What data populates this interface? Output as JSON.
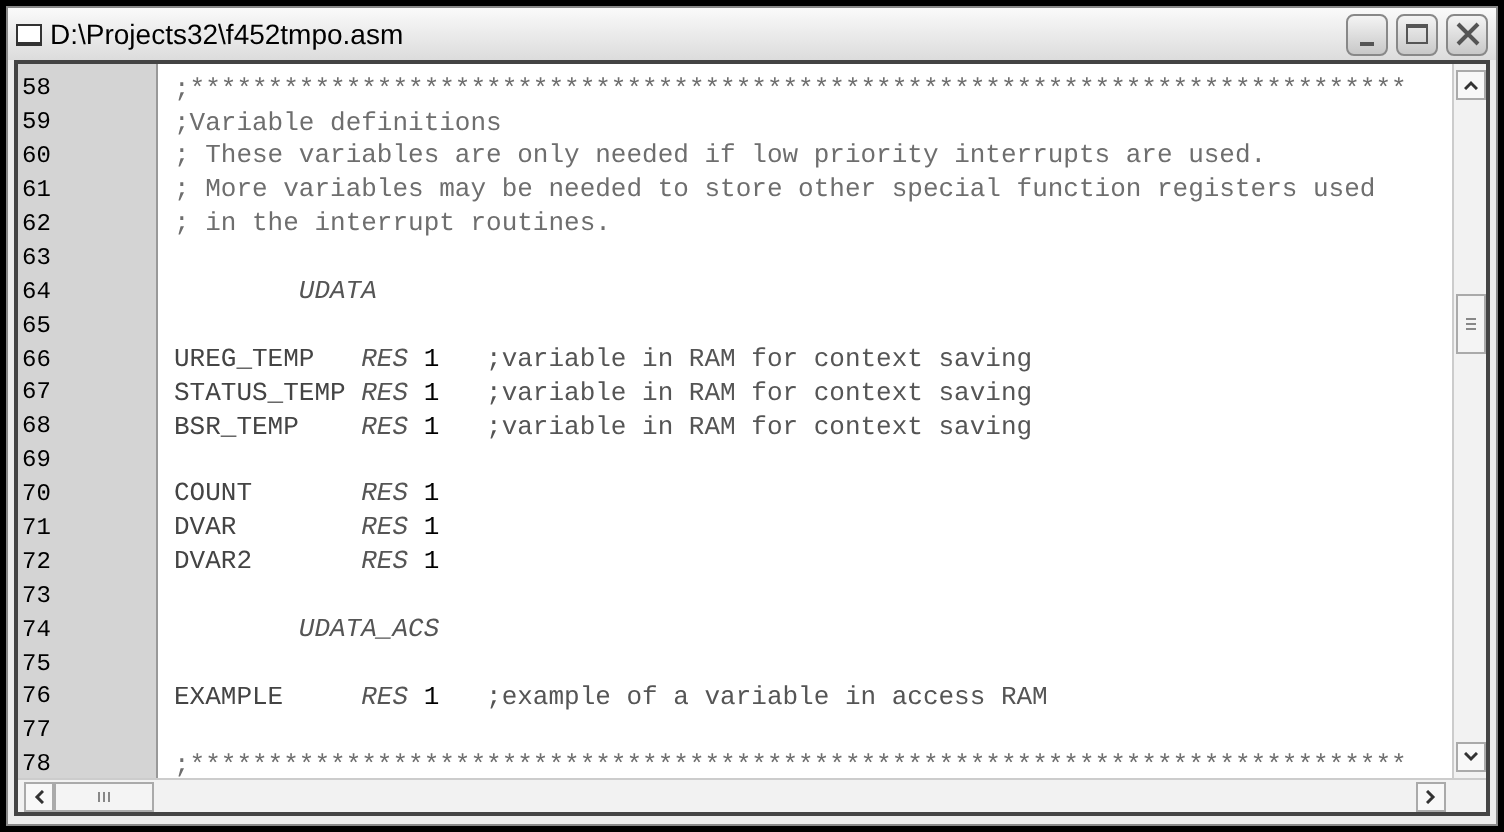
{
  "window": {
    "title": "D:\\Projects32\\f452tmpo.asm"
  },
  "editor": {
    "lines": [
      {
        "number": "58",
        "kind": "comment",
        "text": ";******************************************************************************"
      },
      {
        "number": "59",
        "kind": "comment",
        "text": ";Variable definitions"
      },
      {
        "number": "60",
        "kind": "comment",
        "text": "; These variables are only needed if low priority interrupts are used."
      },
      {
        "number": "61",
        "kind": "comment",
        "text": "; More variables may be needed to store other special function registers used"
      },
      {
        "number": "62",
        "kind": "comment",
        "text": "; in the interrupt routines."
      },
      {
        "number": "63",
        "kind": "blank"
      },
      {
        "number": "64",
        "kind": "section",
        "directive": "UDATA"
      },
      {
        "number": "65",
        "kind": "blank"
      },
      {
        "number": "66",
        "kind": "statement",
        "label": "UREG_TEMP",
        "directive": "RES",
        "operand": "1",
        "comment": ";variable in RAM for context saving"
      },
      {
        "number": "67",
        "kind": "statement",
        "label": "STATUS_TEMP",
        "directive": "RES",
        "operand": "1",
        "comment": ";variable in RAM for context saving"
      },
      {
        "number": "68",
        "kind": "statement",
        "label": "BSR_TEMP",
        "directive": "RES",
        "operand": "1",
        "comment": ";variable in RAM for context saving"
      },
      {
        "number": "69",
        "kind": "blank"
      },
      {
        "number": "70",
        "kind": "statement",
        "label": "COUNT",
        "directive": "RES",
        "operand": "1"
      },
      {
        "number": "71",
        "kind": "statement",
        "label": "DVAR",
        "directive": "RES",
        "operand": "1"
      },
      {
        "number": "72",
        "kind": "statement",
        "label": "DVAR2",
        "directive": "RES",
        "operand": "1"
      },
      {
        "number": "73",
        "kind": "blank"
      },
      {
        "number": "74",
        "kind": "section",
        "directive": "UDATA_ACS"
      },
      {
        "number": "75",
        "kind": "blank"
      },
      {
        "number": "76",
        "kind": "statement",
        "label": "EXAMPLE",
        "directive": "RES",
        "operand": "1",
        "comment": ";example of a variable in access RAM"
      },
      {
        "number": "77",
        "kind": "blank"
      },
      {
        "number": "78",
        "kind": "comment",
        "text": ";******************************************************************************"
      }
    ]
  }
}
